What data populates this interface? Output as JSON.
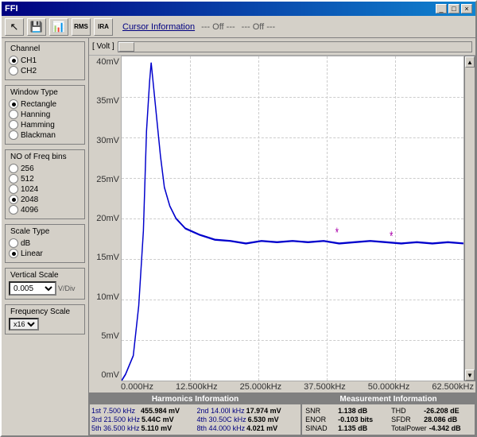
{
  "window": {
    "title": "FFI",
    "title_controls": {
      "minimize": "_",
      "maximize": "□",
      "close": "×"
    }
  },
  "toolbar": {
    "cursor_info_label": "Cursor Information",
    "cursor_off1": "--- Off ---",
    "cursor_off2": "--- Off ---",
    "icons": [
      "cursor",
      "save",
      "export",
      "rms",
      "ira"
    ]
  },
  "sidebar": {
    "channel": {
      "title": "Channel",
      "options": [
        "CH1",
        "CH2"
      ],
      "selected": "CH1"
    },
    "window_type": {
      "title": "Window Type",
      "options": [
        "Rectangle",
        "Hanning",
        "Hamming",
        "Blackman"
      ],
      "selected": "Rectangle"
    },
    "freq_bins": {
      "title": "NO of Freq bins",
      "options": [
        "256",
        "512",
        "1024",
        "2048",
        "4096"
      ],
      "selected": "2048"
    },
    "scale_type": {
      "title": "Scale Type",
      "options": [
        "dB",
        "Linear"
      ],
      "selected": "Linear"
    },
    "vertical_scale": {
      "title": "Vertical Scale",
      "value": "0.005",
      "unit": "V/Div"
    },
    "frequency_scale": {
      "title": "Frequency Scale",
      "value": "x16"
    }
  },
  "chart": {
    "unit_label": "[ Volt ]",
    "y_axis": [
      "40mV",
      "35mV",
      "30mV",
      "25mV",
      "20mV",
      "15mV",
      "10mV",
      "5mV",
      "0mV"
    ],
    "x_axis": [
      "0.000Hz",
      "12.500kHz",
      "25.000kHz",
      "37.500kHz",
      "50.000kHz",
      "62.500kHz"
    ]
  },
  "harmonics_panel": {
    "title": "Harmonics Information",
    "rows": [
      {
        "key": "1st  7.500 kHz",
        "val": "455.984 mV",
        "key2": "2nd  14.00l kHz",
        "val2": "17.974 mV"
      },
      {
        "key": "3rd  21.500 kHz",
        "val": "5.44C mV",
        "key2": "4th  30.50C kHz",
        "val2": "6.530 mV"
      },
      {
        "key": "5th  36.500 kHz",
        "val": "5.110 mV",
        "key2": "8th  44.000 kHz",
        "val2": "4.021 mV"
      }
    ]
  },
  "measurement_panel": {
    "title": "Measurement Information",
    "rows": [
      {
        "key": "SNR",
        "val": "1.138 dB",
        "key2": "THD",
        "val2": "-26.208 dE"
      },
      {
        "key": "ENOR",
        "val": "-0.103 bits",
        "key2": "SFDR",
        "val2": "28.086 dB"
      },
      {
        "key": "SINAD",
        "val": "1.135 dB",
        "key2": "TotalPower",
        "val2": "-4.342 dB"
      }
    ]
  }
}
